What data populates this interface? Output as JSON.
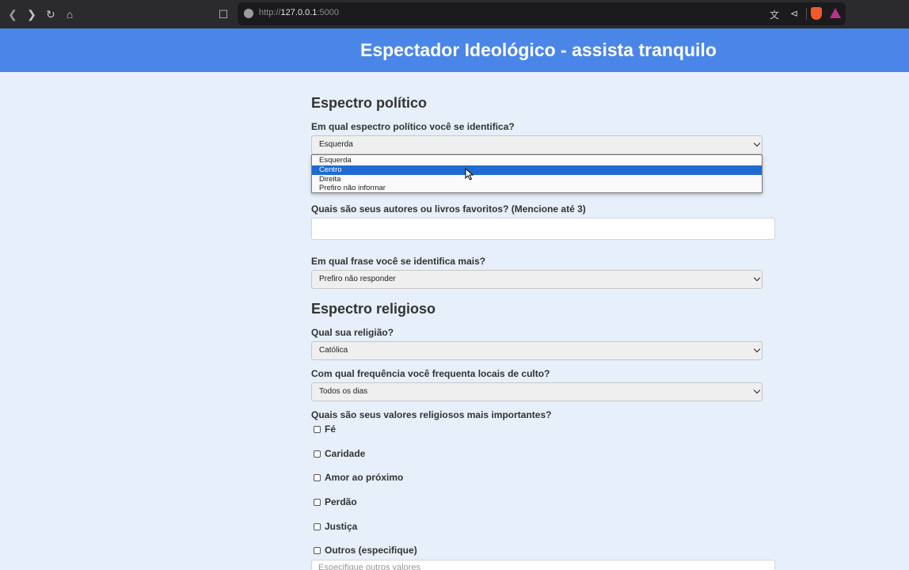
{
  "browser": {
    "url_scheme": "http://",
    "url_host": "127.0.0.1",
    "url_port": ":5000"
  },
  "header": {
    "title": "Espectador Ideológico - assista tranquilo"
  },
  "political": {
    "section_title": "Espectro político",
    "q_spectrum": "Em qual espectro político você se identifica?",
    "spectrum_value": "Esquerda",
    "spectrum_options": [
      "Esquerda",
      "Centro",
      "Direita",
      "Prefiro não informar"
    ],
    "highlighted_option": "Centro",
    "q_authors": "Quais são seus autores ou livros favoritos? (Mencione até 3)",
    "authors_value": "",
    "q_phrase": "Em qual frase você se identifica mais?",
    "phrase_value": "Prefiro não responder"
  },
  "religious": {
    "section_title": "Espectro religioso",
    "q_religion": "Qual sua religião?",
    "religion_value": "Católica",
    "q_frequency": "Com qual frequência você frequenta locais de culto?",
    "frequency_value": "Todos os dias",
    "q_values": "Quais são seus valores religiosos mais importantes?",
    "values": [
      "Fé",
      "Caridade",
      "Amor ao próximo",
      "Perdão",
      "Justiça",
      "Outros (especifique)"
    ],
    "others_placeholder": "Especifique outros valores"
  },
  "colors": {
    "header_bg": "#4a86e8",
    "page_bg": "#e6effa",
    "highlight": "#1f6bd1"
  }
}
